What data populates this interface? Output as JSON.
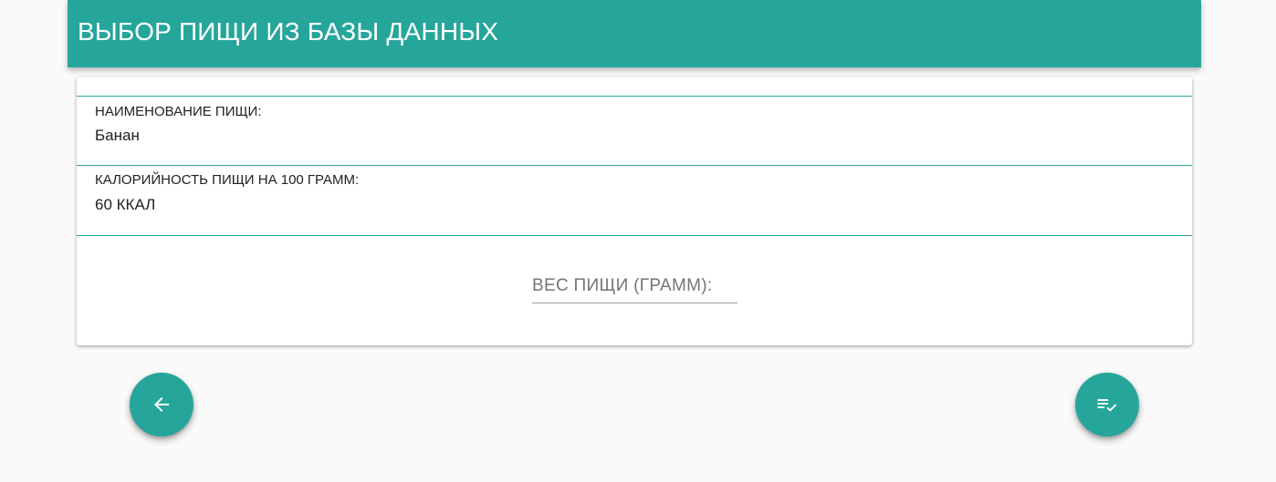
{
  "header": {
    "title": "ВЫБОР ПИЩИ ИЗ БАЗЫ ДАННЫХ"
  },
  "form": {
    "food_name": {
      "label": "НАИМЕНОВАНИЕ ПИЩИ:",
      "value": "Банан"
    },
    "calories": {
      "label": "КАЛОРИЙНОСТЬ ПИЩИ НА 100 ГРАММ:",
      "value": "60 ККАЛ"
    },
    "weight": {
      "placeholder": "ВЕС ПИЩИ (ГРАММ):",
      "value": ""
    }
  },
  "actions": {
    "back_icon": "arrow-left-icon",
    "confirm_icon": "playlist-check-icon"
  },
  "colors": {
    "accent": "#26a69a",
    "background": "#fafafa"
  }
}
